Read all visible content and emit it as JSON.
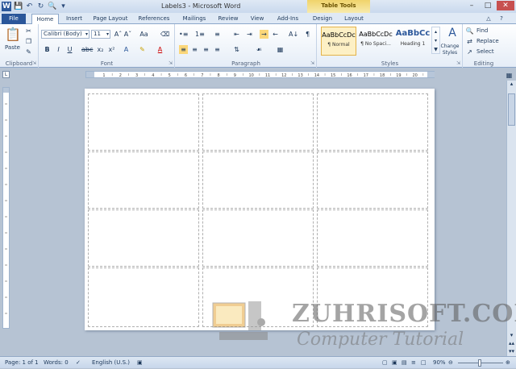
{
  "window": {
    "title": "Labels3 - Microsoft Word",
    "context_tab_group": "Table Tools"
  },
  "qat": {
    "icons": [
      "word-logo",
      "save-icon",
      "undo-icon",
      "redo-icon",
      "print-preview-icon"
    ]
  },
  "tabs": {
    "file": "File",
    "home": "Home",
    "insert": "Insert",
    "page_layout": "Page Layout",
    "references": "References",
    "mailings": "Mailings",
    "review": "Review",
    "view": "View",
    "addins": "Add-Ins",
    "design": "Design",
    "layout": "Layout"
  },
  "ribbon": {
    "clipboard": {
      "label": "Clipboard",
      "paste": "Paste"
    },
    "font": {
      "label": "Font",
      "font_name": "Calibri (Body)",
      "font_size": "11"
    },
    "paragraph": {
      "label": "Paragraph"
    },
    "styles": {
      "label": "Styles",
      "items": [
        {
          "preview": "AaBbCcDc",
          "name": "¶ Normal"
        },
        {
          "preview": "AaBbCcDc",
          "name": "¶ No Spaci..."
        },
        {
          "preview": "AaBbCc",
          "name": "Heading 1"
        }
      ],
      "change_styles": "Change Styles"
    },
    "editing": {
      "label": "Editing",
      "find": "Find",
      "replace": "Replace",
      "select": "Select"
    }
  },
  "ruler": {
    "numbers": [
      "1",
      "2",
      "3",
      "4",
      "5",
      "6",
      "7",
      "8",
      "9",
      "10",
      "11",
      "12",
      "13",
      "14",
      "15",
      "16",
      "17",
      "18",
      "19",
      "20"
    ]
  },
  "status": {
    "page": "Page: 1 of 1",
    "words": "Words: 0",
    "language": "English (U.S.)",
    "zoom": "90%"
  },
  "watermark": {
    "title": "ZUHRISOFT.COM",
    "subtitle": "Computer Tutorial"
  },
  "colors": {
    "file_tab": "#2b579a",
    "context_tab": "#f0d36b",
    "accent": "#1e395b"
  }
}
